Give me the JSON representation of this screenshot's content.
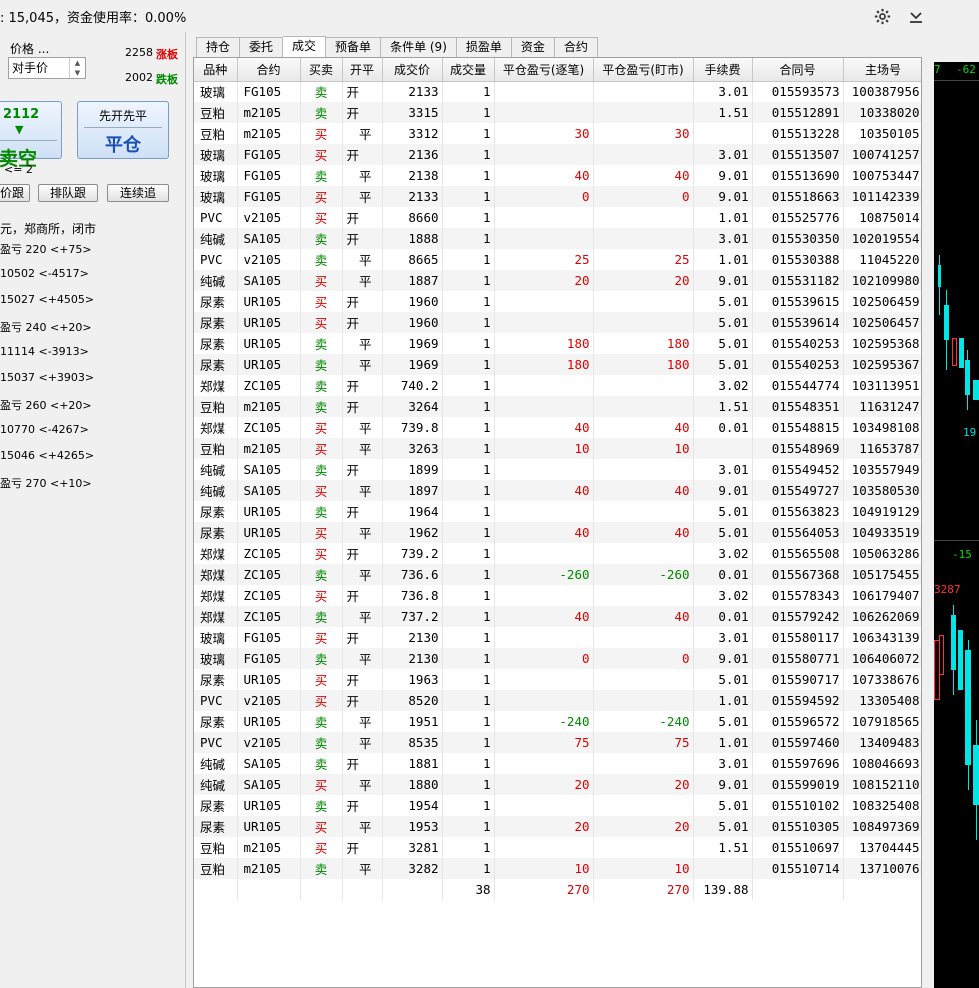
{
  "header": {
    "status_text": ": 15,045，资金使用率：0.00%",
    "settings_icon": "gear-icon",
    "menu_icon": "chevron-down-icon"
  },
  "left_panel": {
    "price_label": "价格 ...",
    "price_type": "对手价",
    "limit_up_price": "2258",
    "limit_up_label": "涨板",
    "limit_down_price": "2002",
    "limit_down_label": "跌板",
    "sell_btn_price": "2112",
    "sell_btn_label": "卖空",
    "close_btn_top": "先开先平",
    "close_btn_label": "平仓",
    "qty_note": "<= 2",
    "btn_follow": "价跟",
    "btn_queue": "排队跟",
    "btn_continuous": "连续追",
    "exchange_info": "元，郑商所，闭市",
    "lines": [
      "盈亏 220  <+75>",
      "10502  <-4517>",
      "15027  <+4505>",
      "盈亏 240  <+20>",
      "11114  <-3913>",
      "15037  <+3903>",
      "盈亏 260  <+20>",
      "10770  <-4267>",
      "15046  <+4265>",
      "盈亏 270  <+10>"
    ]
  },
  "tabs": [
    "持仓",
    "委托",
    "成交",
    "预备单",
    "条件单 (9)",
    "损盈单",
    "资金",
    "合约"
  ],
  "active_tab": 2,
  "columns": [
    "品种",
    "合约",
    "买卖",
    "开平",
    "成交价",
    "成交量",
    "平仓盈亏(逐笔)",
    "平仓盈亏(盯市)",
    "手续费",
    "合同号",
    "主场号"
  ],
  "rows": [
    [
      "玻璃",
      "FG105",
      "卖",
      "开",
      "2133",
      "1",
      "",
      "",
      "3.01",
      "015593573",
      "100387956"
    ],
    [
      "豆粕",
      "m2105",
      "卖",
      "开",
      "3315",
      "1",
      "",
      "",
      "1.51",
      "015512891",
      "10338020"
    ],
    [
      "豆粕",
      "m2105",
      "买",
      "平",
      "3312",
      "1",
      "30",
      "30",
      "",
      "015513228",
      "10350105"
    ],
    [
      "玻璃",
      "FG105",
      "买",
      "开",
      "2136",
      "1",
      "",
      "",
      "3.01",
      "015513507",
      "100741257"
    ],
    [
      "玻璃",
      "FG105",
      "卖",
      "平",
      "2138",
      "1",
      "40",
      "40",
      "9.01",
      "015513690",
      "100753447"
    ],
    [
      "玻璃",
      "FG105",
      "买",
      "平",
      "2133",
      "1",
      "0",
      "0",
      "9.01",
      "015518663",
      "101142339"
    ],
    [
      "PVC",
      "v2105",
      "买",
      "开",
      "8660",
      "1",
      "",
      "",
      "1.01",
      "015525776",
      "10875014"
    ],
    [
      "纯碱",
      "SA105",
      "卖",
      "开",
      "1888",
      "1",
      "",
      "",
      "3.01",
      "015530350",
      "102019554"
    ],
    [
      "PVC",
      "v2105",
      "卖",
      "平",
      "8665",
      "1",
      "25",
      "25",
      "1.01",
      "015530388",
      "11045220"
    ],
    [
      "纯碱",
      "SA105",
      "买",
      "平",
      "1887",
      "1",
      "20",
      "20",
      "9.01",
      "015531182",
      "102109980"
    ],
    [
      "尿素",
      "UR105",
      "买",
      "开",
      "1960",
      "1",
      "",
      "",
      "5.01",
      "015539615",
      "102506459"
    ],
    [
      "尿素",
      "UR105",
      "买",
      "开",
      "1960",
      "1",
      "",
      "",
      "5.01",
      "015539614",
      "102506457"
    ],
    [
      "尿素",
      "UR105",
      "卖",
      "平",
      "1969",
      "1",
      "180",
      "180",
      "5.01",
      "015540253",
      "102595368"
    ],
    [
      "尿素",
      "UR105",
      "卖",
      "平",
      "1969",
      "1",
      "180",
      "180",
      "5.01",
      "015540253",
      "102595367"
    ],
    [
      "郑煤",
      "ZC105",
      "卖",
      "开",
      "740.2",
      "1",
      "",
      "",
      "3.02",
      "015544774",
      "103113951"
    ],
    [
      "豆粕",
      "m2105",
      "卖",
      "开",
      "3264",
      "1",
      "",
      "",
      "1.51",
      "015548351",
      "11631247"
    ],
    [
      "郑煤",
      "ZC105",
      "买",
      "平",
      "739.8",
      "1",
      "40",
      "40",
      "0.01",
      "015548815",
      "103498108"
    ],
    [
      "豆粕",
      "m2105",
      "买",
      "平",
      "3263",
      "1",
      "10",
      "10",
      "",
      "015548969",
      "11653787"
    ],
    [
      "纯碱",
      "SA105",
      "卖",
      "开",
      "1899",
      "1",
      "",
      "",
      "3.01",
      "015549452",
      "103557949"
    ],
    [
      "纯碱",
      "SA105",
      "买",
      "平",
      "1897",
      "1",
      "40",
      "40",
      "9.01",
      "015549727",
      "103580530"
    ],
    [
      "尿素",
      "UR105",
      "卖",
      "开",
      "1964",
      "1",
      "",
      "",
      "5.01",
      "015563823",
      "104919129"
    ],
    [
      "尿素",
      "UR105",
      "买",
      "平",
      "1962",
      "1",
      "40",
      "40",
      "5.01",
      "015564053",
      "104933519"
    ],
    [
      "郑煤",
      "ZC105",
      "买",
      "开",
      "739.2",
      "1",
      "",
      "",
      "3.02",
      "015565508",
      "105063286"
    ],
    [
      "郑煤",
      "ZC105",
      "卖",
      "平",
      "736.6",
      "1",
      "-260",
      "-260",
      "0.01",
      "015567368",
      "105175455"
    ],
    [
      "郑煤",
      "ZC105",
      "买",
      "开",
      "736.8",
      "1",
      "",
      "",
      "3.02",
      "015578343",
      "106179407"
    ],
    [
      "郑煤",
      "ZC105",
      "卖",
      "平",
      "737.2",
      "1",
      "40",
      "40",
      "0.01",
      "015579242",
      "106262069"
    ],
    [
      "玻璃",
      "FG105",
      "买",
      "开",
      "2130",
      "1",
      "",
      "",
      "3.01",
      "015580117",
      "106343139"
    ],
    [
      "玻璃",
      "FG105",
      "卖",
      "平",
      "2130",
      "1",
      "0",
      "0",
      "9.01",
      "015580771",
      "106406072"
    ],
    [
      "尿素",
      "UR105",
      "买",
      "开",
      "1963",
      "1",
      "",
      "",
      "5.01",
      "015590717",
      "107338676"
    ],
    [
      "PVC",
      "v2105",
      "买",
      "开",
      "8520",
      "1",
      "",
      "",
      "1.01",
      "015594592",
      "13305408"
    ],
    [
      "尿素",
      "UR105",
      "卖",
      "平",
      "1951",
      "1",
      "-240",
      "-240",
      "5.01",
      "015596572",
      "107918565"
    ],
    [
      "PVC",
      "v2105",
      "卖",
      "平",
      "8535",
      "1",
      "75",
      "75",
      "1.01",
      "015597460",
      "13409483"
    ],
    [
      "纯碱",
      "SA105",
      "卖",
      "开",
      "1881",
      "1",
      "",
      "",
      "3.01",
      "015597696",
      "108046693"
    ],
    [
      "纯碱",
      "SA105",
      "买",
      "平",
      "1880",
      "1",
      "20",
      "20",
      "9.01",
      "015599019",
      "108152110"
    ],
    [
      "尿素",
      "UR105",
      "卖",
      "开",
      "1954",
      "1",
      "",
      "",
      "5.01",
      "015510102",
      "108325408"
    ],
    [
      "尿素",
      "UR105",
      "买",
      "平",
      "1953",
      "1",
      "20",
      "20",
      "5.01",
      "015510305",
      "108497369"
    ],
    [
      "豆粕",
      "m2105",
      "买",
      "开",
      "3281",
      "1",
      "",
      "",
      "1.51",
      "015510697",
      "13704445"
    ],
    [
      "豆粕",
      "m2105",
      "卖",
      "平",
      "3282",
      "1",
      "10",
      "10",
      "",
      "015510714",
      "13710076"
    ]
  ],
  "totals": [
    "",
    "",
    "",
    "",
    "",
    "38",
    "270",
    "270",
    "139.88",
    "",
    ""
  ],
  "right_chart": {
    "labels": [
      "7",
      "-62",
      "19",
      "-15 /",
      "3287"
    ]
  },
  "colors": {
    "buy": "#e00000",
    "sell": "#008800",
    "limit_up": "#e00000",
    "limit_down": "#008800",
    "candle_down": "#00e5e5",
    "candle_up": "#ff3333"
  }
}
